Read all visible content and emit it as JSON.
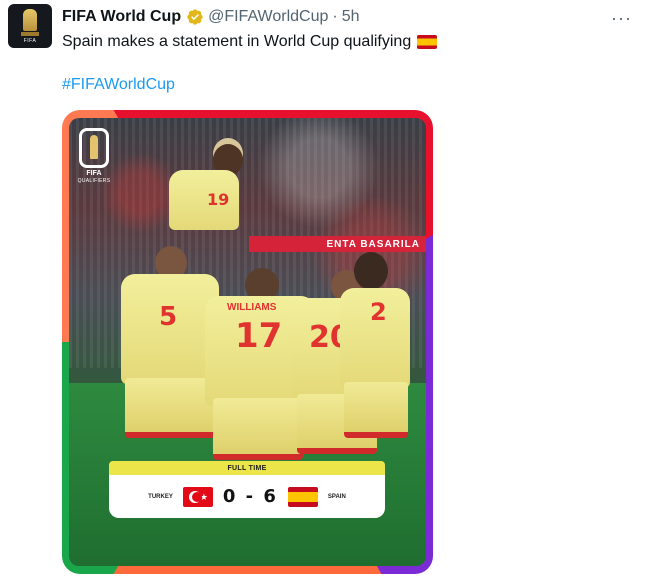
{
  "tweet": {
    "author_name": "FIFA World Cup",
    "handle": "@FIFAWorldCup",
    "separator": "·",
    "time": "5h",
    "text": "Spain makes a statement in World Cup qualifying",
    "hashtag": "#FIFAWorldCup",
    "more_glyph": "···"
  },
  "avatar": {
    "icon": "fifa-world-cup-logo",
    "tag": "FIFA"
  },
  "media": {
    "logo_fifa": "FIFA",
    "logo_subtitle": "QUALIFIERS",
    "stadium_banner": "ENTA BASARILA",
    "full_time_label": "FULL TIME",
    "home_team": "TURKEY",
    "away_team": "SPAIN",
    "score": "0 - 6",
    "shirt_numbers": [
      "19",
      "5",
      "17",
      "20",
      "2"
    ],
    "shirt_name": "WILLIAMS"
  },
  "colors": {
    "hashtag": "#1d9bf0",
    "muted": "#536471",
    "verified": "#e2b719",
    "spain_kit": "#f2ef9c",
    "full_time_bar": "#ebe54a"
  }
}
